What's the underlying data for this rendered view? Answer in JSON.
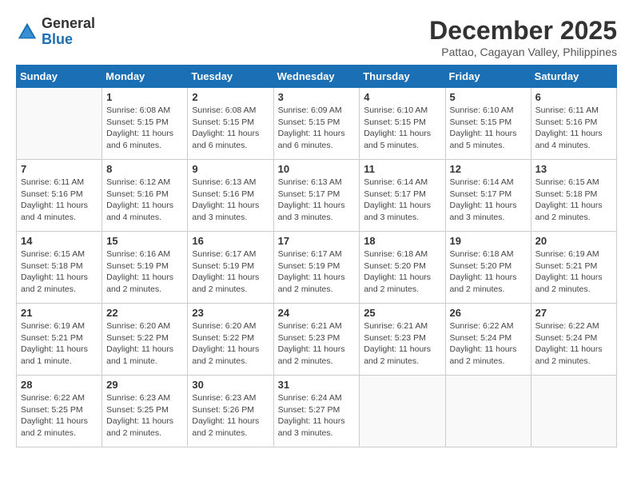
{
  "header": {
    "logo_general": "General",
    "logo_blue": "Blue",
    "month_title": "December 2025",
    "subtitle": "Pattao, Cagayan Valley, Philippines"
  },
  "weekdays": [
    "Sunday",
    "Monday",
    "Tuesday",
    "Wednesday",
    "Thursday",
    "Friday",
    "Saturday"
  ],
  "weeks": [
    [
      {
        "day": "",
        "sunrise": "",
        "sunset": "",
        "daylight": ""
      },
      {
        "day": "1",
        "sunrise": "Sunrise: 6:08 AM",
        "sunset": "Sunset: 5:15 PM",
        "daylight": "Daylight: 11 hours and 6 minutes."
      },
      {
        "day": "2",
        "sunrise": "Sunrise: 6:08 AM",
        "sunset": "Sunset: 5:15 PM",
        "daylight": "Daylight: 11 hours and 6 minutes."
      },
      {
        "day": "3",
        "sunrise": "Sunrise: 6:09 AM",
        "sunset": "Sunset: 5:15 PM",
        "daylight": "Daylight: 11 hours and 6 minutes."
      },
      {
        "day": "4",
        "sunrise": "Sunrise: 6:10 AM",
        "sunset": "Sunset: 5:15 PM",
        "daylight": "Daylight: 11 hours and 5 minutes."
      },
      {
        "day": "5",
        "sunrise": "Sunrise: 6:10 AM",
        "sunset": "Sunset: 5:15 PM",
        "daylight": "Daylight: 11 hours and 5 minutes."
      },
      {
        "day": "6",
        "sunrise": "Sunrise: 6:11 AM",
        "sunset": "Sunset: 5:16 PM",
        "daylight": "Daylight: 11 hours and 4 minutes."
      }
    ],
    [
      {
        "day": "7",
        "sunrise": "Sunrise: 6:11 AM",
        "sunset": "Sunset: 5:16 PM",
        "daylight": "Daylight: 11 hours and 4 minutes."
      },
      {
        "day": "8",
        "sunrise": "Sunrise: 6:12 AM",
        "sunset": "Sunset: 5:16 PM",
        "daylight": "Daylight: 11 hours and 4 minutes."
      },
      {
        "day": "9",
        "sunrise": "Sunrise: 6:13 AM",
        "sunset": "Sunset: 5:16 PM",
        "daylight": "Daylight: 11 hours and 3 minutes."
      },
      {
        "day": "10",
        "sunrise": "Sunrise: 6:13 AM",
        "sunset": "Sunset: 5:17 PM",
        "daylight": "Daylight: 11 hours and 3 minutes."
      },
      {
        "day": "11",
        "sunrise": "Sunrise: 6:14 AM",
        "sunset": "Sunset: 5:17 PM",
        "daylight": "Daylight: 11 hours and 3 minutes."
      },
      {
        "day": "12",
        "sunrise": "Sunrise: 6:14 AM",
        "sunset": "Sunset: 5:17 PM",
        "daylight": "Daylight: 11 hours and 3 minutes."
      },
      {
        "day": "13",
        "sunrise": "Sunrise: 6:15 AM",
        "sunset": "Sunset: 5:18 PM",
        "daylight": "Daylight: 11 hours and 2 minutes."
      }
    ],
    [
      {
        "day": "14",
        "sunrise": "Sunrise: 6:15 AM",
        "sunset": "Sunset: 5:18 PM",
        "daylight": "Daylight: 11 hours and 2 minutes."
      },
      {
        "day": "15",
        "sunrise": "Sunrise: 6:16 AM",
        "sunset": "Sunset: 5:19 PM",
        "daylight": "Daylight: 11 hours and 2 minutes."
      },
      {
        "day": "16",
        "sunrise": "Sunrise: 6:17 AM",
        "sunset": "Sunset: 5:19 PM",
        "daylight": "Daylight: 11 hours and 2 minutes."
      },
      {
        "day": "17",
        "sunrise": "Sunrise: 6:17 AM",
        "sunset": "Sunset: 5:19 PM",
        "daylight": "Daylight: 11 hours and 2 minutes."
      },
      {
        "day": "18",
        "sunrise": "Sunrise: 6:18 AM",
        "sunset": "Sunset: 5:20 PM",
        "daylight": "Daylight: 11 hours and 2 minutes."
      },
      {
        "day": "19",
        "sunrise": "Sunrise: 6:18 AM",
        "sunset": "Sunset: 5:20 PM",
        "daylight": "Daylight: 11 hours and 2 minutes."
      },
      {
        "day": "20",
        "sunrise": "Sunrise: 6:19 AM",
        "sunset": "Sunset: 5:21 PM",
        "daylight": "Daylight: 11 hours and 2 minutes."
      }
    ],
    [
      {
        "day": "21",
        "sunrise": "Sunrise: 6:19 AM",
        "sunset": "Sunset: 5:21 PM",
        "daylight": "Daylight: 11 hours and 1 minute."
      },
      {
        "day": "22",
        "sunrise": "Sunrise: 6:20 AM",
        "sunset": "Sunset: 5:22 PM",
        "daylight": "Daylight: 11 hours and 1 minute."
      },
      {
        "day": "23",
        "sunrise": "Sunrise: 6:20 AM",
        "sunset": "Sunset: 5:22 PM",
        "daylight": "Daylight: 11 hours and 2 minutes."
      },
      {
        "day": "24",
        "sunrise": "Sunrise: 6:21 AM",
        "sunset": "Sunset: 5:23 PM",
        "daylight": "Daylight: 11 hours and 2 minutes."
      },
      {
        "day": "25",
        "sunrise": "Sunrise: 6:21 AM",
        "sunset": "Sunset: 5:23 PM",
        "daylight": "Daylight: 11 hours and 2 minutes."
      },
      {
        "day": "26",
        "sunrise": "Sunrise: 6:22 AM",
        "sunset": "Sunset: 5:24 PM",
        "daylight": "Daylight: 11 hours and 2 minutes."
      },
      {
        "day": "27",
        "sunrise": "Sunrise: 6:22 AM",
        "sunset": "Sunset: 5:24 PM",
        "daylight": "Daylight: 11 hours and 2 minutes."
      }
    ],
    [
      {
        "day": "28",
        "sunrise": "Sunrise: 6:22 AM",
        "sunset": "Sunset: 5:25 PM",
        "daylight": "Daylight: 11 hours and 2 minutes."
      },
      {
        "day": "29",
        "sunrise": "Sunrise: 6:23 AM",
        "sunset": "Sunset: 5:25 PM",
        "daylight": "Daylight: 11 hours and 2 minutes."
      },
      {
        "day": "30",
        "sunrise": "Sunrise: 6:23 AM",
        "sunset": "Sunset: 5:26 PM",
        "daylight": "Daylight: 11 hours and 2 minutes."
      },
      {
        "day": "31",
        "sunrise": "Sunrise: 6:24 AM",
        "sunset": "Sunset: 5:27 PM",
        "daylight": "Daylight: 11 hours and 3 minutes."
      },
      {
        "day": "",
        "sunrise": "",
        "sunset": "",
        "daylight": ""
      },
      {
        "day": "",
        "sunrise": "",
        "sunset": "",
        "daylight": ""
      },
      {
        "day": "",
        "sunrise": "",
        "sunset": "",
        "daylight": ""
      }
    ]
  ]
}
